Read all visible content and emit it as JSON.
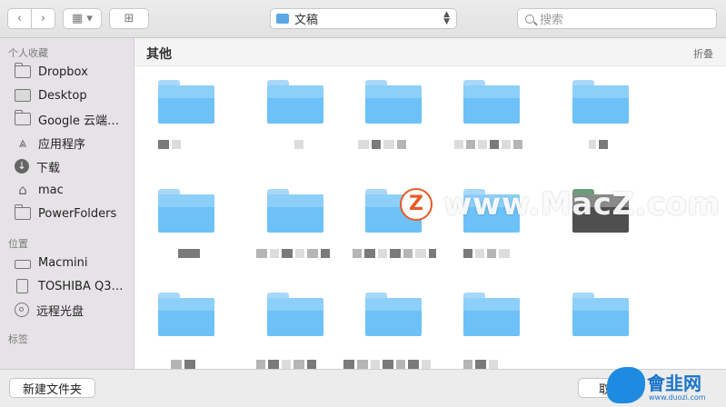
{
  "toolbar": {
    "back_glyph": "‹",
    "forward_glyph": "›",
    "view_glyph": "▦ ▾",
    "new_folder_glyph": "⊞",
    "location": "文稿",
    "location_arrows": "▲▼",
    "search_placeholder": "搜索"
  },
  "sidebar": {
    "favorites_title": "个人收藏",
    "favorites": [
      {
        "label": "Dropbox",
        "icon": "folder-icon"
      },
      {
        "label": "Desktop",
        "icon": "desktop-icon"
      },
      {
        "label": "Google 云端…",
        "icon": "folder-icon"
      },
      {
        "label": "应用程序",
        "icon": "applications-icon"
      },
      {
        "label": "下载",
        "icon": "downloads-icon"
      },
      {
        "label": "mac",
        "icon": "home-icon"
      },
      {
        "label": "PowerFolders",
        "icon": "folder-icon"
      }
    ],
    "locations_title": "位置",
    "locations": [
      {
        "label": "Macmini",
        "icon": "computer-icon"
      },
      {
        "label": "TOSHIBA Q3…",
        "icon": "drive-icon"
      },
      {
        "label": "远程光盘",
        "icon": "disc-icon"
      }
    ],
    "tags_title": "标签"
  },
  "content": {
    "group_title": "其他",
    "collapse_label": "折叠"
  },
  "watermark": {
    "logo_letter": "Z",
    "text": "www.MacZ.com",
    "corner_text": "會韭网",
    "corner_sub": "www.duozi.com"
  },
  "bottom": {
    "new_folder": "新建文件夹",
    "cancel": "取消"
  }
}
